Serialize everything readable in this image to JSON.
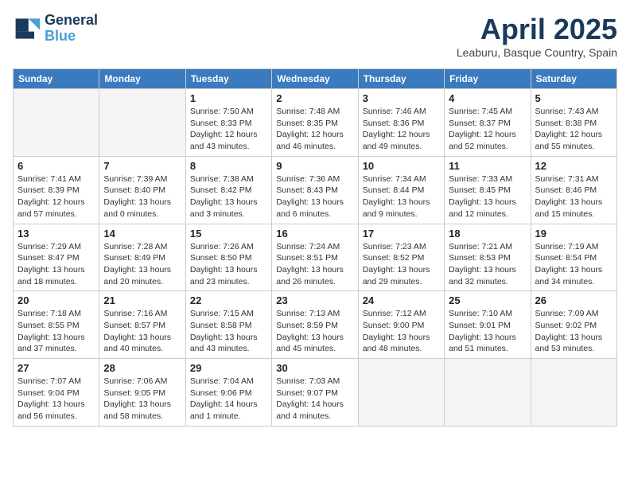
{
  "logo": {
    "line1": "General",
    "line2": "Blue"
  },
  "title": "April 2025",
  "location": "Leaburu, Basque Country, Spain",
  "weekdays": [
    "Sunday",
    "Monday",
    "Tuesday",
    "Wednesday",
    "Thursday",
    "Friday",
    "Saturday"
  ],
  "weeks": [
    [
      {
        "day": "",
        "info": ""
      },
      {
        "day": "",
        "info": ""
      },
      {
        "day": "1",
        "info": "Sunrise: 7:50 AM\nSunset: 8:33 PM\nDaylight: 12 hours and 43 minutes."
      },
      {
        "day": "2",
        "info": "Sunrise: 7:48 AM\nSunset: 8:35 PM\nDaylight: 12 hours and 46 minutes."
      },
      {
        "day": "3",
        "info": "Sunrise: 7:46 AM\nSunset: 8:36 PM\nDaylight: 12 hours and 49 minutes."
      },
      {
        "day": "4",
        "info": "Sunrise: 7:45 AM\nSunset: 8:37 PM\nDaylight: 12 hours and 52 minutes."
      },
      {
        "day": "5",
        "info": "Sunrise: 7:43 AM\nSunset: 8:38 PM\nDaylight: 12 hours and 55 minutes."
      }
    ],
    [
      {
        "day": "6",
        "info": "Sunrise: 7:41 AM\nSunset: 8:39 PM\nDaylight: 12 hours and 57 minutes."
      },
      {
        "day": "7",
        "info": "Sunrise: 7:39 AM\nSunset: 8:40 PM\nDaylight: 13 hours and 0 minutes."
      },
      {
        "day": "8",
        "info": "Sunrise: 7:38 AM\nSunset: 8:42 PM\nDaylight: 13 hours and 3 minutes."
      },
      {
        "day": "9",
        "info": "Sunrise: 7:36 AM\nSunset: 8:43 PM\nDaylight: 13 hours and 6 minutes."
      },
      {
        "day": "10",
        "info": "Sunrise: 7:34 AM\nSunset: 8:44 PM\nDaylight: 13 hours and 9 minutes."
      },
      {
        "day": "11",
        "info": "Sunrise: 7:33 AM\nSunset: 8:45 PM\nDaylight: 13 hours and 12 minutes."
      },
      {
        "day": "12",
        "info": "Sunrise: 7:31 AM\nSunset: 8:46 PM\nDaylight: 13 hours and 15 minutes."
      }
    ],
    [
      {
        "day": "13",
        "info": "Sunrise: 7:29 AM\nSunset: 8:47 PM\nDaylight: 13 hours and 18 minutes."
      },
      {
        "day": "14",
        "info": "Sunrise: 7:28 AM\nSunset: 8:49 PM\nDaylight: 13 hours and 20 minutes."
      },
      {
        "day": "15",
        "info": "Sunrise: 7:26 AM\nSunset: 8:50 PM\nDaylight: 13 hours and 23 minutes."
      },
      {
        "day": "16",
        "info": "Sunrise: 7:24 AM\nSunset: 8:51 PM\nDaylight: 13 hours and 26 minutes."
      },
      {
        "day": "17",
        "info": "Sunrise: 7:23 AM\nSunset: 8:52 PM\nDaylight: 13 hours and 29 minutes."
      },
      {
        "day": "18",
        "info": "Sunrise: 7:21 AM\nSunset: 8:53 PM\nDaylight: 13 hours and 32 minutes."
      },
      {
        "day": "19",
        "info": "Sunrise: 7:19 AM\nSunset: 8:54 PM\nDaylight: 13 hours and 34 minutes."
      }
    ],
    [
      {
        "day": "20",
        "info": "Sunrise: 7:18 AM\nSunset: 8:55 PM\nDaylight: 13 hours and 37 minutes."
      },
      {
        "day": "21",
        "info": "Sunrise: 7:16 AM\nSunset: 8:57 PM\nDaylight: 13 hours and 40 minutes."
      },
      {
        "day": "22",
        "info": "Sunrise: 7:15 AM\nSunset: 8:58 PM\nDaylight: 13 hours and 43 minutes."
      },
      {
        "day": "23",
        "info": "Sunrise: 7:13 AM\nSunset: 8:59 PM\nDaylight: 13 hours and 45 minutes."
      },
      {
        "day": "24",
        "info": "Sunrise: 7:12 AM\nSunset: 9:00 PM\nDaylight: 13 hours and 48 minutes."
      },
      {
        "day": "25",
        "info": "Sunrise: 7:10 AM\nSunset: 9:01 PM\nDaylight: 13 hours and 51 minutes."
      },
      {
        "day": "26",
        "info": "Sunrise: 7:09 AM\nSunset: 9:02 PM\nDaylight: 13 hours and 53 minutes."
      }
    ],
    [
      {
        "day": "27",
        "info": "Sunrise: 7:07 AM\nSunset: 9:04 PM\nDaylight: 13 hours and 56 minutes."
      },
      {
        "day": "28",
        "info": "Sunrise: 7:06 AM\nSunset: 9:05 PM\nDaylight: 13 hours and 58 minutes."
      },
      {
        "day": "29",
        "info": "Sunrise: 7:04 AM\nSunset: 9:06 PM\nDaylight: 14 hours and 1 minute."
      },
      {
        "day": "30",
        "info": "Sunrise: 7:03 AM\nSunset: 9:07 PM\nDaylight: 14 hours and 4 minutes."
      },
      {
        "day": "",
        "info": ""
      },
      {
        "day": "",
        "info": ""
      },
      {
        "day": "",
        "info": ""
      }
    ]
  ]
}
